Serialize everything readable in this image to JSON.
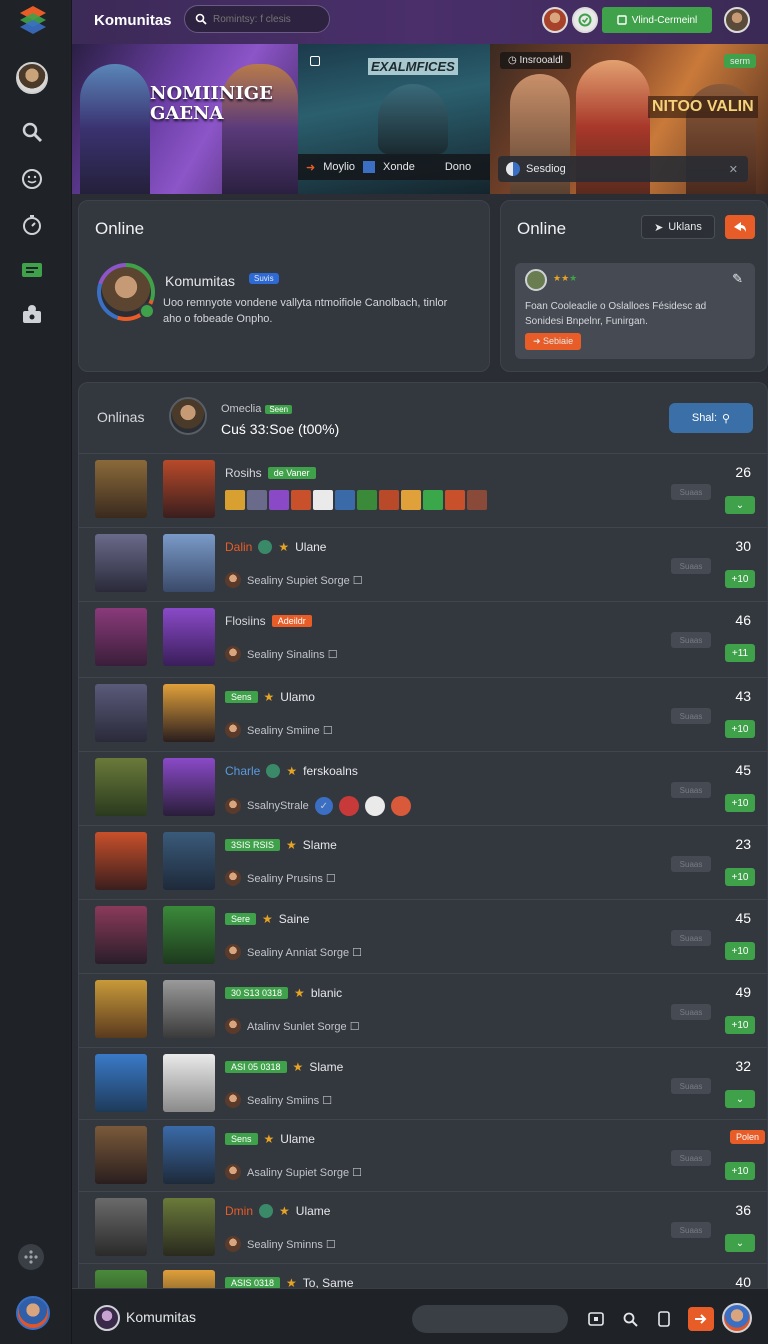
{
  "app": {
    "brand": "Komunitas"
  },
  "search": {
    "placeholder": "Romintsy: f clesis"
  },
  "topbar": {
    "cta_label": "Vlind-Cermeinl"
  },
  "banners": {
    "b1": {
      "title": "NOMIINIGE GAENA"
    },
    "b2": {
      "title": "EXALMFICES",
      "links": [
        "Moylio",
        "Xonde",
        "Dono"
      ]
    },
    "b3": {
      "tag": "Insrooaldl",
      "badge": "serm",
      "title": "NITOO VALIN",
      "strip": "Sesdiog"
    }
  },
  "profile_card": {
    "heading": "Online",
    "name": "Komumitas",
    "pill": "Suvis",
    "desc": "Uoo remnyote vondene vallyta ntmoifiole Canolbach, tinlor aho o fobeade Onpho."
  },
  "side_card": {
    "heading": "Online",
    "btn_label": "Uklans",
    "note": "Foan Cooleaclie o Oslalloes Fésidesc ad Sonidesi Bnpelnr, Funirgan.",
    "action": "Sebiaie"
  },
  "list": {
    "header_left": "Onlinas",
    "header_sub": "Omeclia",
    "header_badge": "Seen",
    "header_main": "Cuś 33:Soe (t00%)",
    "header_btn": "Shal:",
    "ghost_label": "Suaas",
    "rows": [
      {
        "title": "Rosihs",
        "chip": "de Vaner",
        "chip_color": "green",
        "subtitle": "",
        "num": "26",
        "badge": "⌄"
      },
      {
        "title": "Dalin",
        "chip": "",
        "tail": "Ulane",
        "subtitle": "Sealiny Supiet Sorge ☐",
        "num": "30",
        "badge": "+10"
      },
      {
        "title": "Flosiins",
        "chip": "Adeildr",
        "chip_color": "orange",
        "subtitle": "Sealiny Sinalins ☐",
        "num": "46",
        "badge": "+11"
      },
      {
        "title": "",
        "chip": "Sens",
        "chip_color": "green",
        "tail": "Ulamo",
        "subtitle": "Sealiny Smiine ☐",
        "num": "43",
        "badge": "+10"
      },
      {
        "title": "Charle",
        "chip": "",
        "tail": "ferskoalns",
        "subtitle": "SsalnyStrale",
        "num": "45",
        "badge": "+10"
      },
      {
        "title": "",
        "chip": "3SIS RSIS",
        "chip_color": "green",
        "tail": "Slame",
        "subtitle": "Sealiny Prusins ☐",
        "num": "23",
        "badge": "+10"
      },
      {
        "title": "",
        "chip": "Sere",
        "chip_color": "green",
        "tail": "Saine",
        "subtitle": "Sealiny Anniat Sorge ☐",
        "num": "45",
        "badge": "+10"
      },
      {
        "title": "",
        "chip": "30 S13 0318",
        "chip_color": "green",
        "tail": "blanic",
        "subtitle": "Atalinv Sunlet Sorge ☐",
        "num": "49",
        "badge": "+10"
      },
      {
        "title": "",
        "chip": "ASI 05 0318",
        "chip_color": "green",
        "tail": "Slame",
        "subtitle": "Sealiny Smiins ☐",
        "num": "32",
        "badge": "⌄"
      },
      {
        "title": "",
        "chip": "Sens",
        "chip_color": "green",
        "tail": "Ulame",
        "subtitle": "Asaliny Supiet Sorge ☐",
        "num": "Polen",
        "badge": "+10"
      },
      {
        "title": "Dmin",
        "chip": "",
        "tail": "Ulame",
        "subtitle": "Sealiny Sminns ☐",
        "num": "36",
        "badge": "⌄"
      },
      {
        "title": "",
        "chip": "ASIS 0318",
        "chip_color": "green",
        "tail": "To, Same",
        "subtitle": "",
        "num": "40",
        "badge": ""
      }
    ]
  },
  "bottombar": {
    "name": "Komumitas"
  },
  "colors": {
    "accent_green": "#3fa14a",
    "accent_orange": "#e85d27",
    "accent_purple": "#4a2f6b",
    "accent_blue": "#3a6fc4"
  }
}
